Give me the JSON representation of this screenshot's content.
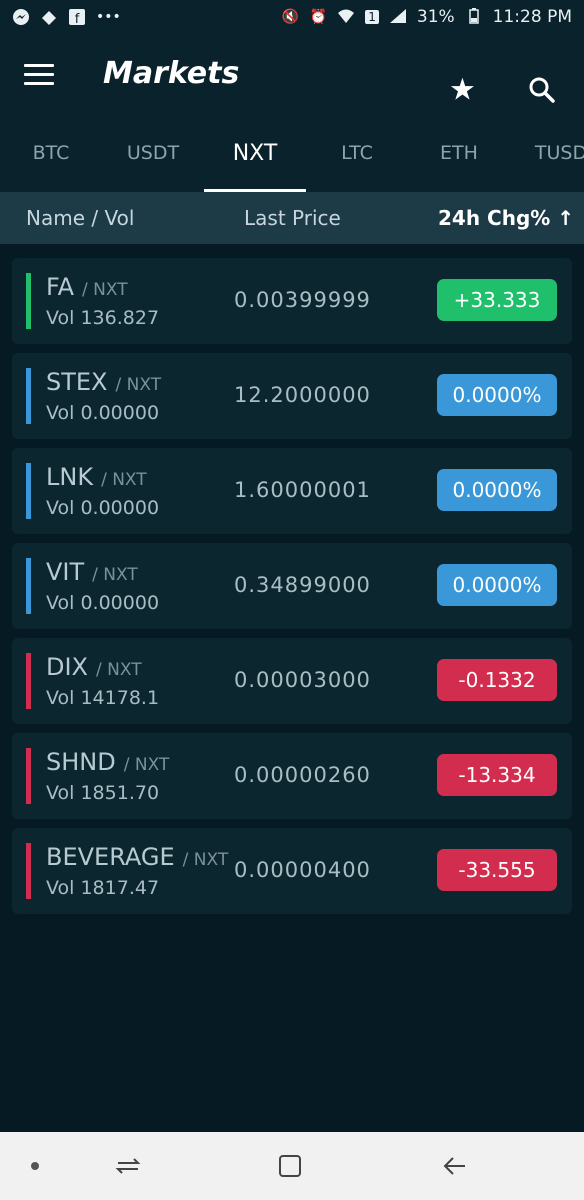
{
  "status": {
    "icons_left": [
      "messenger-icon",
      "feedly-icon",
      "facebook-icon",
      "more-icon"
    ],
    "battery": "31%",
    "time": "11:28 PM",
    "sim": "1"
  },
  "appbar": {
    "title": "Markets"
  },
  "tabs": [
    "BTC",
    "USDT",
    "NXT",
    "LTC",
    "ETH",
    "TUSD"
  ],
  "active_tab": "NXT",
  "columns": {
    "name": "Name / Vol",
    "price": "Last Price",
    "change": "24h Chg% ↑"
  },
  "rows": [
    {
      "symbol": "FA",
      "quote": "/ NXT",
      "vol": "Vol 136.827",
      "price": "0.00399999",
      "change": "+33.333",
      "trend": "up"
    },
    {
      "symbol": "STEX",
      "quote": "/ NXT",
      "vol": "Vol 0.00000",
      "price": "12.2000000",
      "change": "0.0000%",
      "trend": "flat"
    },
    {
      "symbol": "LNK",
      "quote": "/ NXT",
      "vol": "Vol 0.00000",
      "price": "1.60000001",
      "change": "0.0000%",
      "trend": "flat"
    },
    {
      "symbol": "VIT",
      "quote": "/ NXT",
      "vol": "Vol 0.00000",
      "price": "0.34899000",
      "change": "0.0000%",
      "trend": "flat"
    },
    {
      "symbol": "DIX",
      "quote": "/ NXT",
      "vol": "Vol 14178.1",
      "price": "0.00003000",
      "change": "-0.1332",
      "trend": "down"
    },
    {
      "symbol": "SHND",
      "quote": "/ NXT",
      "vol": "Vol 1851.70",
      "price": "0.00000260",
      "change": "-13.334",
      "trend": "down"
    },
    {
      "symbol": "BEVERAGE",
      "quote": "/ NXT",
      "vol": "Vol 1817.47",
      "price": "0.00000400",
      "change": "-33.555",
      "trend": "down"
    }
  ],
  "colors": {
    "up": "#1fbf6c",
    "flat": "#3a98d8",
    "down": "#d22d4e",
    "background": "#051a22",
    "header": "#0a222b"
  }
}
